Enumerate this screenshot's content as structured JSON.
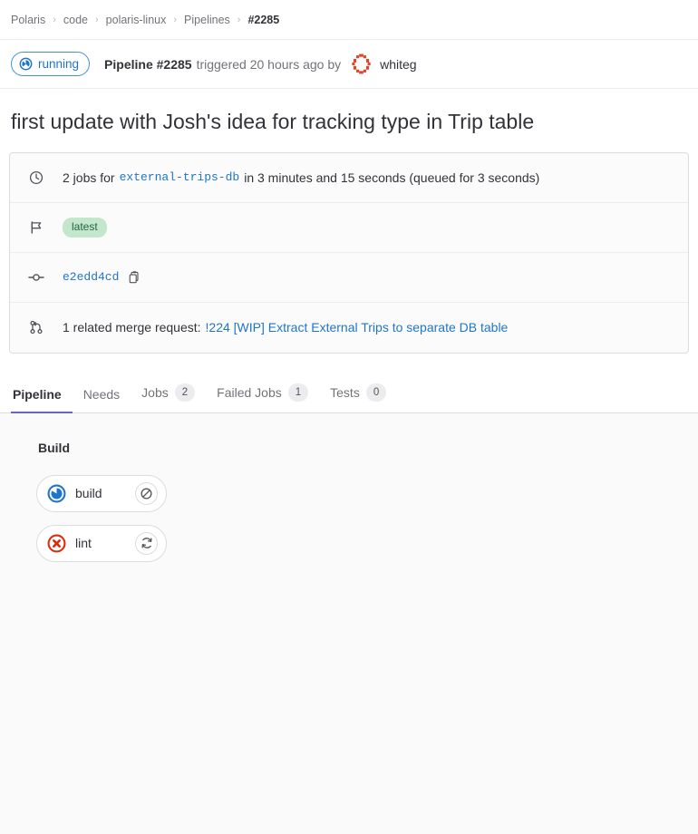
{
  "breadcrumb": {
    "items": [
      {
        "label": "Polaris",
        "current": false
      },
      {
        "label": "code",
        "current": false
      },
      {
        "label": "polaris-linux",
        "current": false
      },
      {
        "label": "Pipelines",
        "current": false
      },
      {
        "label": "#2285",
        "current": true
      }
    ],
    "separator": "›"
  },
  "status": {
    "badge_label": "running",
    "badge_icon": "status-running-icon",
    "pipeline_label": "Pipeline #2285",
    "triggered_text": "triggered 20 hours ago by",
    "username": "whiteg",
    "avatar_icon": "identicon-avatar"
  },
  "title": "first update with Josh's idea for tracking type in Trip table",
  "info": {
    "jobs_row": {
      "icon": "clock-icon",
      "prefix": "2 jobs for",
      "branch": "external-trips-db",
      "duration": "in 3 minutes and 15 seconds (queued for 3 seconds)"
    },
    "tag_row": {
      "icon": "flag-icon",
      "badge": "latest"
    },
    "commit_row": {
      "icon": "commit-icon",
      "sha": "e2edd4cd",
      "copy_icon": "copy-clipboard-icon"
    },
    "mr_row": {
      "icon": "merge-request-icon",
      "prefix": "1 related merge request:",
      "link": "!224 [WIP] Extract External Trips to separate DB table"
    }
  },
  "tabs": [
    {
      "label": "Pipeline",
      "count": null,
      "active": true
    },
    {
      "label": "Needs",
      "count": null,
      "active": false
    },
    {
      "label": "Jobs",
      "count": "2",
      "active": false
    },
    {
      "label": "Failed Jobs",
      "count": "1",
      "active": false
    },
    {
      "label": "Tests",
      "count": "0",
      "active": false
    }
  ],
  "pipeline_graph": {
    "stages": [
      {
        "name": "Build",
        "jobs": [
          {
            "name": "build",
            "status": "running",
            "status_icon": "status-running-icon",
            "action": "cancel",
            "action_icon": "cancel-icon"
          },
          {
            "name": "lint",
            "status": "failed",
            "status_icon": "status-failed-icon",
            "action": "retry",
            "action_icon": "retry-icon"
          }
        ]
      }
    ]
  },
  "colors": {
    "running_blue": "#1f75cb",
    "failed_red": "#dd2b0e",
    "link_blue": "#1f75cb",
    "tab_active": "#6666c4",
    "badge_green_bg": "#c3e6cd",
    "badge_green_text": "#24663b"
  }
}
